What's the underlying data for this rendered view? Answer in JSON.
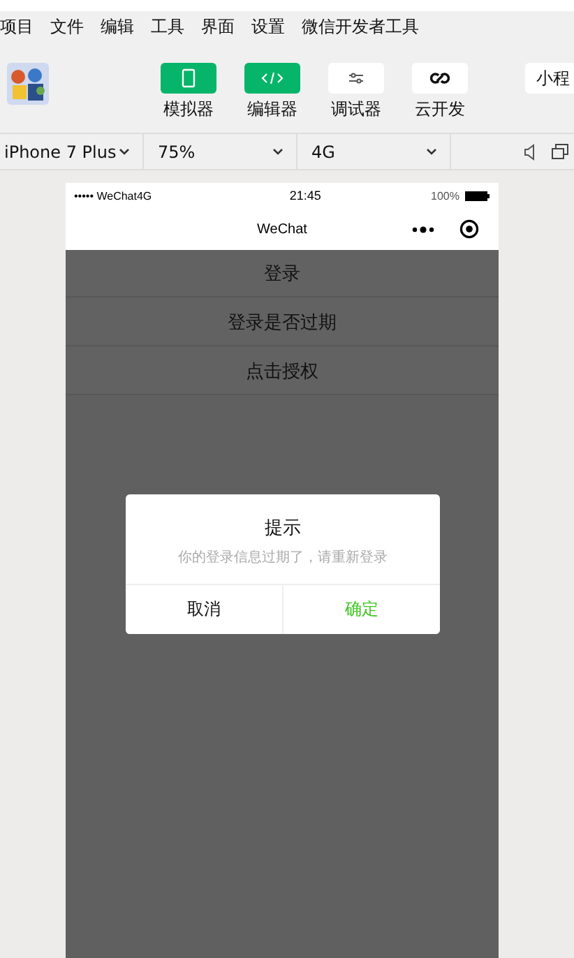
{
  "menu": [
    "项目",
    "文件",
    "编辑",
    "工具",
    "界面",
    "设置",
    "微信开发者工具"
  ],
  "toolbar": {
    "buttons": [
      {
        "label": "模拟器",
        "on": true,
        "kind": "phone"
      },
      {
        "label": "编辑器",
        "on": true,
        "kind": "code"
      },
      {
        "label": "调试器",
        "on": false,
        "kind": "sliders"
      },
      {
        "label": "云开发",
        "on": false,
        "kind": "link"
      }
    ],
    "partial_button": "小程"
  },
  "device_bar": {
    "selects": [
      "iPhone 7 Plus",
      "75%",
      "4G"
    ]
  },
  "phone": {
    "status": {
      "carrier": "••••• WeChat4G",
      "time": "21:45",
      "battery": "100%"
    },
    "nav_title": "WeChat",
    "buttons": [
      "登录",
      "登录是否过期",
      "点击授权"
    ],
    "modal": {
      "title": "提示",
      "message": "你的登录信息过期了，请重新登录",
      "cancel": "取消",
      "confirm": "确定"
    }
  }
}
